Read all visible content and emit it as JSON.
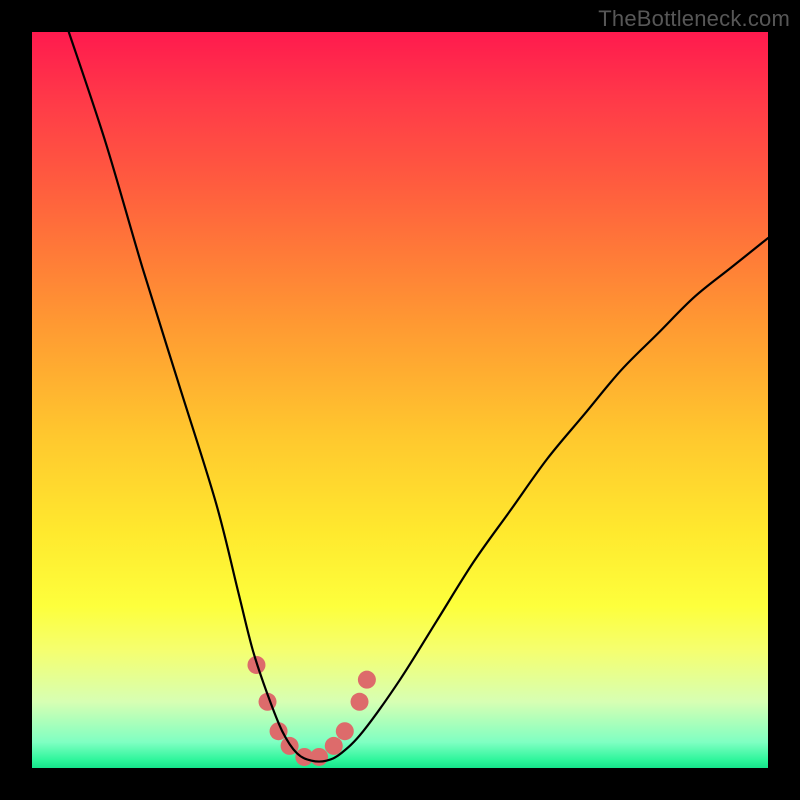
{
  "watermark": "TheBottleneck.com",
  "chart_data": {
    "type": "line",
    "title": "",
    "xlabel": "",
    "ylabel": "",
    "xlim": [
      0,
      100
    ],
    "ylim": [
      0,
      100
    ],
    "series": [
      {
        "name": "bottleneck-curve",
        "x": [
          5,
          10,
          15,
          20,
          25,
          28,
          30,
          32,
          34,
          36,
          38,
          40,
          42,
          45,
          50,
          55,
          60,
          65,
          70,
          75,
          80,
          85,
          90,
          95,
          100
        ],
        "values": [
          100,
          85,
          68,
          52,
          36,
          24,
          16,
          10,
          5,
          2,
          1,
          1,
          2,
          5,
          12,
          20,
          28,
          35,
          42,
          48,
          54,
          59,
          64,
          68,
          72
        ]
      }
    ],
    "markers": {
      "name": "highlight-points",
      "x": [
        30.5,
        32,
        33.5,
        35,
        37,
        39,
        41,
        42.5,
        44.5,
        45.5
      ],
      "values": [
        14,
        9,
        5,
        3,
        1.5,
        1.5,
        3,
        5,
        9,
        12
      ],
      "color": "#dd6b6b",
      "radius_px": 9
    },
    "background_gradient": {
      "top_color": "#ff1a4e",
      "mid_color": "#ffe92e",
      "bottom_color": "#16e48b"
    }
  }
}
